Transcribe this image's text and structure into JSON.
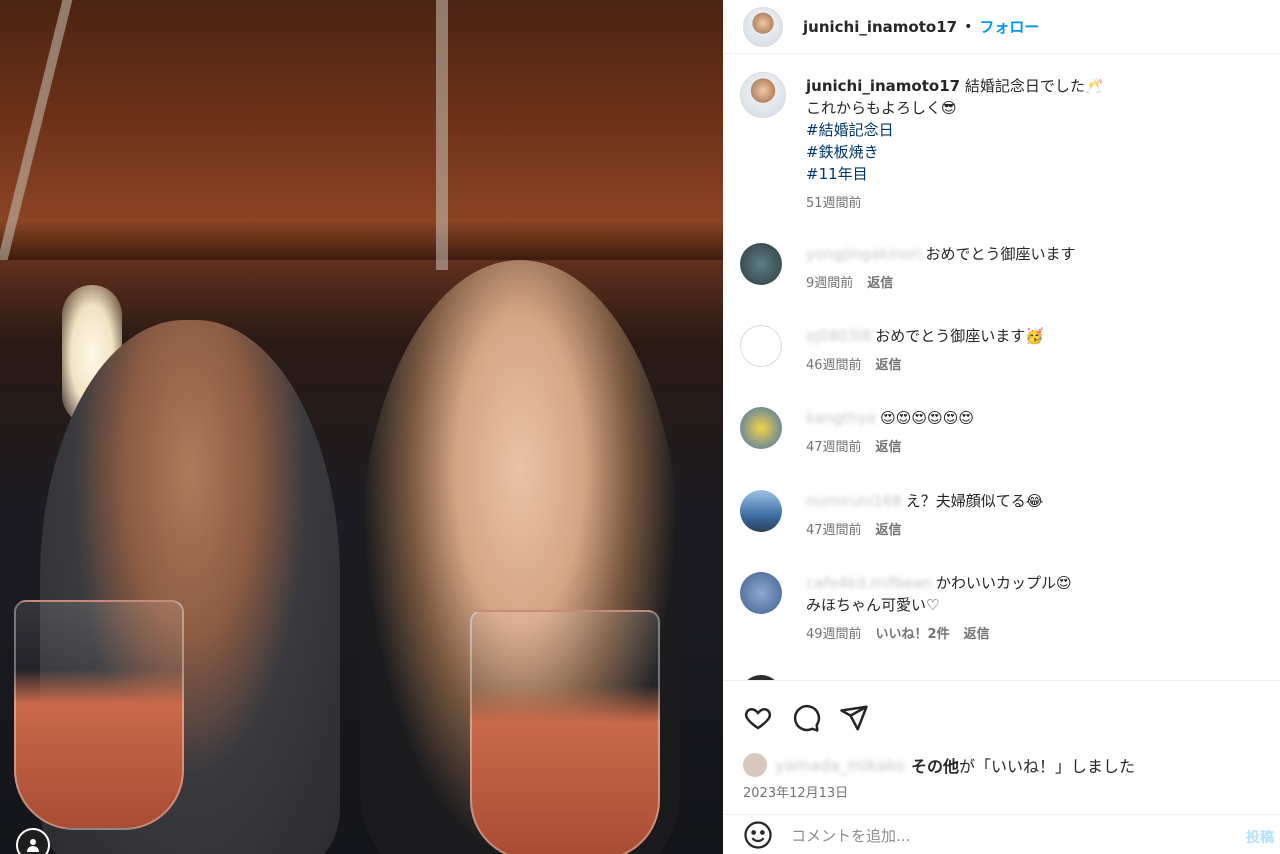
{
  "header": {
    "username": "junichi_inamoto17",
    "separator": "•",
    "follow_label": "フォロー"
  },
  "caption": {
    "username": "junichi_inamoto17",
    "line1": "結婚記念日でした🥂",
    "line2": "これからもよろしく😎",
    "hashtags": [
      "#結婚記念日",
      "#鉄板焼き",
      "#11年目"
    ],
    "time": "51週間前"
  },
  "comments": [
    {
      "user": "yongjingakinori",
      "text": "おめでとう御座います",
      "time": "9週間前",
      "reply": "返信",
      "likes": ""
    },
    {
      "user": "ej0803l8",
      "text": "おめでとう御座います🥳",
      "time": "46週間前",
      "reply": "返信",
      "likes": ""
    },
    {
      "user": "kangthye",
      "text": "😍😍😍😍😍😍",
      "time": "47週間前",
      "reply": "返信",
      "likes": ""
    },
    {
      "user": "numiruni168",
      "text": "え？夫婦顔似てる😂",
      "time": "47週間前",
      "reply": "返信",
      "likes": ""
    },
    {
      "user": "cafe4kd.mifbean",
      "text": "かわいいカップル😍",
      "text2": "みほちゃん可愛い♡",
      "time": "49週間前",
      "reply": "返信",
      "likes": "いいね！2件"
    }
  ],
  "actions": {
    "icons": [
      "heart-icon",
      "comment-icon",
      "share-icon"
    ],
    "liked_by_blur": "yamada_mikako",
    "liked_by_bold": "その他",
    "liked_by_suffix": "が「いいね！」しました",
    "date": "2023年12月13日",
    "comment_placeholder": "コメントを追加...",
    "post_label": "投稿"
  }
}
